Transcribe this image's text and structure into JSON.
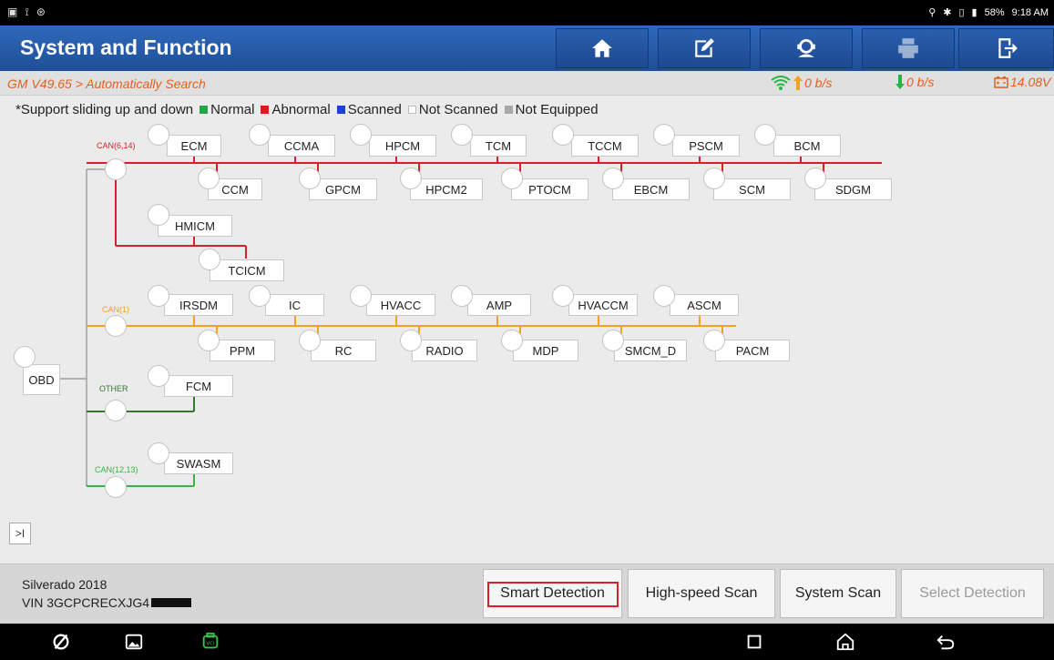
{
  "status_bar": {
    "left_icons": [
      "gallery-icon",
      "usb-icon",
      "vci-status-icon"
    ],
    "battery": "58%",
    "time": "9:18 AM"
  },
  "header": {
    "title": "System and Function",
    "buttons": [
      "home-icon",
      "edit-icon",
      "support-icon",
      "print-icon",
      "exit-icon"
    ]
  },
  "info": {
    "path": "GM V49.65 > Automatically Search",
    "upload_rate": "0 b/s",
    "download_rate": "0 b/s",
    "voltage": "14.08V"
  },
  "legend": {
    "note": "*Support sliding up and down",
    "items": [
      {
        "label": "Normal",
        "color": "#1fa845"
      },
      {
        "label": "Abnormal",
        "color": "#e01b1b"
      },
      {
        "label": "Scanned",
        "color": "#1e3fd8"
      },
      {
        "label": "Not Scanned",
        "color": "#ffffff"
      },
      {
        "label": "Not Equipped",
        "color": "#a8a8a8"
      }
    ]
  },
  "topology": {
    "root": "OBD",
    "buses": [
      {
        "label": "CAN(6,14)",
        "color": "#d8202a",
        "top_modules": [
          "ECM",
          "CCMA",
          "HPCM",
          "TCM",
          "TCCM",
          "PSCM",
          "BCM"
        ],
        "bottom_modules": [
          "CCM",
          "GPCM",
          "HPCM2",
          "PTOCM",
          "EBCM",
          "SCM",
          "SDGM"
        ],
        "branch_modules": [
          "HMICM",
          "TCICM"
        ]
      },
      {
        "label": "CAN(1)",
        "color": "#f0a223",
        "top_modules": [
          "IRSDM",
          "IC",
          "HVACC",
          "AMP",
          "HVACCM",
          "ASCM"
        ],
        "bottom_modules": [
          "PPM",
          "RC",
          "RADIO",
          "MDP",
          "SMCM_D",
          "PACM"
        ]
      },
      {
        "label": "OTHER",
        "color": "#2f7a2f",
        "modules": [
          "FCM"
        ]
      },
      {
        "label": "CAN(12,13)",
        "color": "#3cb04a",
        "modules": [
          "SWASM"
        ]
      }
    ]
  },
  "expand_label": ">I",
  "vehicle": {
    "model": "Silverado 2018",
    "vin": "VIN 3GCPCRECXJG4"
  },
  "actions": {
    "smart_detection": "Smart Detection",
    "high_speed_scan": "High-speed Scan",
    "system_scan": "System Scan",
    "select_detection": "Select Detection"
  }
}
